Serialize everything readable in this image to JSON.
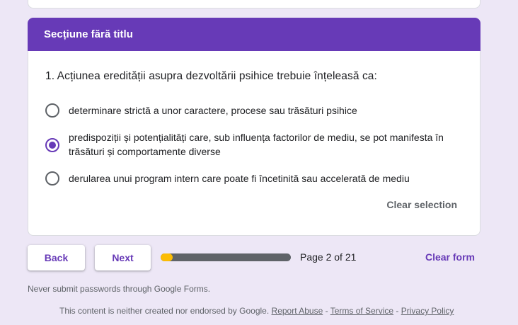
{
  "section": {
    "title": "Secțiune fără titlu"
  },
  "question": {
    "text": "1. Acțiunea eredității asupra dezvoltării psihice trebuie înțeleasă ca:",
    "options": [
      {
        "label": "determinare strictă a unor caractere, procese sau trăsături psihice",
        "selected": false
      },
      {
        "label": "predispoziții și potențialități care, sub influența factorilor de mediu, se pot manifesta în trăsături și comportamente diverse",
        "selected": true
      },
      {
        "label": "derularea unui program intern care poate fi încetinită sau accelerată de mediu",
        "selected": false
      }
    ],
    "clear_selection": "Clear selection"
  },
  "navigation": {
    "back_label": "Back",
    "next_label": "Next",
    "progress": 0.095,
    "page_indicator": "Page 2 of 21",
    "clear_form_label": "Clear form"
  },
  "footer": {
    "warning": "Never submit passwords through Google Forms.",
    "disclaimer": "This content is neither created nor endorsed by Google.",
    "report_abuse": "Report Abuse",
    "separator": " - ",
    "terms": "Terms of Service",
    "privacy": "Privacy Policy"
  },
  "colors": {
    "accent": "#673ab7",
    "background": "#ede7f6",
    "progress_fill": "#fbbc04",
    "progress_track": "#5f6368"
  }
}
